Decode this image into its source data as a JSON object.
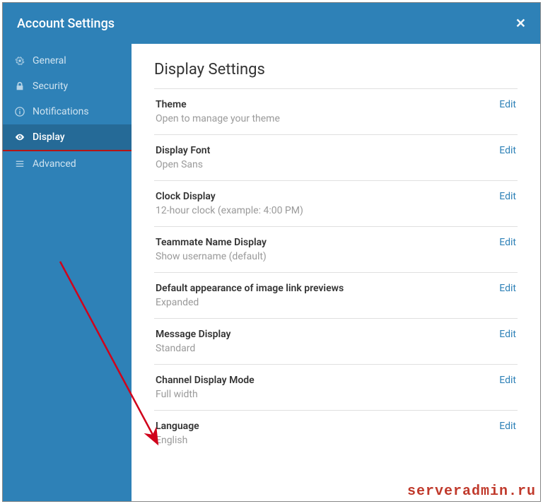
{
  "header": {
    "title": "Account Settings"
  },
  "sidebar": {
    "items": [
      {
        "label": "General",
        "icon": "gear"
      },
      {
        "label": "Security",
        "icon": "lock"
      },
      {
        "label": "Notifications",
        "icon": "info"
      },
      {
        "label": "Display",
        "icon": "eye"
      },
      {
        "label": "Advanced",
        "icon": "list"
      }
    ],
    "active_index": 3
  },
  "main": {
    "title": "Display Settings",
    "edit_label": "Edit",
    "settings": [
      {
        "title": "Theme",
        "value": "Open to manage your theme"
      },
      {
        "title": "Display Font",
        "value": "Open Sans"
      },
      {
        "title": "Clock Display",
        "value": "12-hour clock (example: 4:00 PM)"
      },
      {
        "title": "Teammate Name Display",
        "value": "Show username (default)"
      },
      {
        "title": "Default appearance of image link previews",
        "value": "Expanded"
      },
      {
        "title": "Message Display",
        "value": "Standard"
      },
      {
        "title": "Channel Display Mode",
        "value": "Full width"
      },
      {
        "title": "Language",
        "value": "English"
      }
    ]
  },
  "watermark": "serveradmin.ru"
}
